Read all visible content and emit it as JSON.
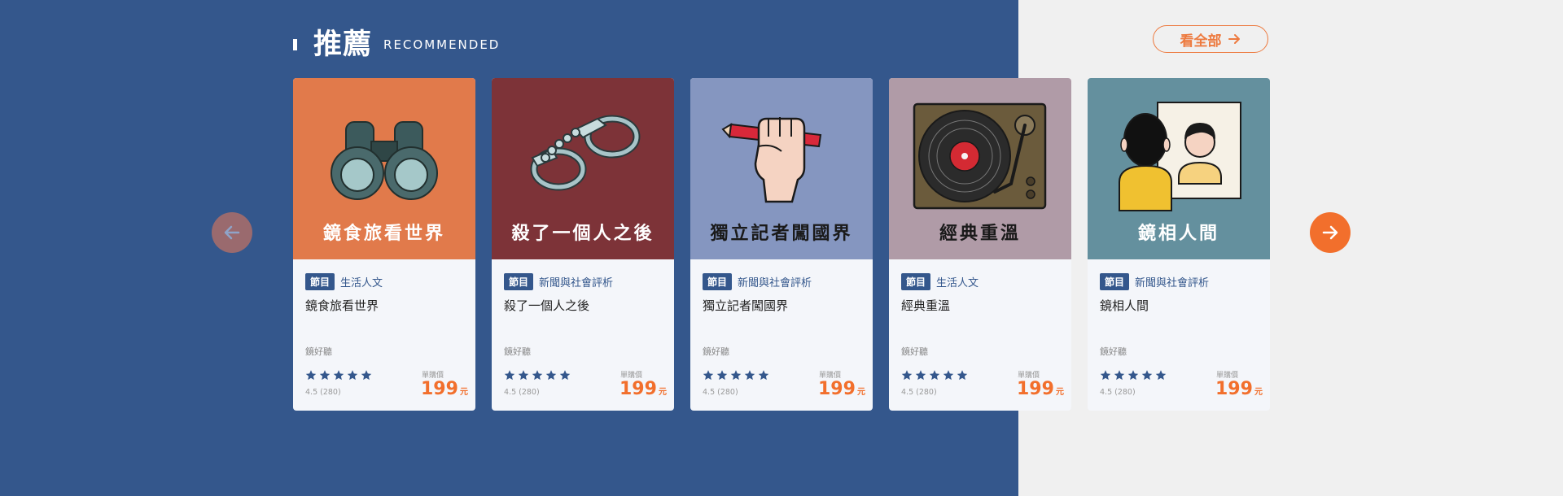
{
  "section": {
    "title": "推薦",
    "subtitle": "RECOMMENDED",
    "see_all_label": "看全部"
  },
  "colors": {
    "background_blue": "#34578c",
    "accent_orange": "#f26f2c",
    "badge_blue": "#34578c"
  },
  "navigation": {
    "prev_icon": "arrow-left-icon",
    "next_icon": "arrow-right-icon"
  },
  "cards": [
    {
      "cover_title": "鏡食旅看世界",
      "cover_color": "#e17a4b",
      "cover_icon": "binoculars-icon",
      "badge": "節目",
      "category": "生活人文",
      "title": "鏡食旅看世界",
      "publisher": "鏡好聽",
      "rating": "4.5 (280)",
      "stars": 5,
      "price_label": "單購價",
      "price": "199",
      "price_unit": "元"
    },
    {
      "cover_title": "殺了一個人之後",
      "cover_color": "#7d3338",
      "cover_icon": "handcuffs-icon",
      "badge": "節目",
      "category": "新聞與社會評析",
      "title": "殺了一個人之後",
      "publisher": "鏡好聽",
      "rating": "4.5 (280)",
      "stars": 5,
      "price_label": "單購價",
      "price": "199",
      "price_unit": "元"
    },
    {
      "cover_title": "獨立記者闖國界",
      "cover_color": "#8596c0",
      "cover_icon": "fist-pencil-icon",
      "badge": "節目",
      "category": "新聞與社會評析",
      "title": "獨立記者闖國界",
      "publisher": "鏡好聽",
      "rating": "4.5 (280)",
      "stars": 5,
      "price_label": "單購價",
      "price": "199",
      "price_unit": "元"
    },
    {
      "cover_title": "經典重溫",
      "cover_color": "#b09ba7",
      "cover_icon": "turntable-icon",
      "badge": "節目",
      "category": "生活人文",
      "title": "經典重溫",
      "publisher": "鏡好聽",
      "rating": "4.5 (280)",
      "stars": 5,
      "price_label": "單購價",
      "price": "199",
      "price_unit": "元"
    },
    {
      "cover_title": "鏡相人間",
      "cover_color": "#64909e",
      "cover_icon": "mirror-person-icon",
      "badge": "節目",
      "category": "新聞與社會評析",
      "title": "鏡相人間",
      "publisher": "鏡好聽",
      "rating": "4.5 (280)",
      "stars": 5,
      "price_label": "單購價",
      "price": "199",
      "price_unit": "元"
    }
  ]
}
